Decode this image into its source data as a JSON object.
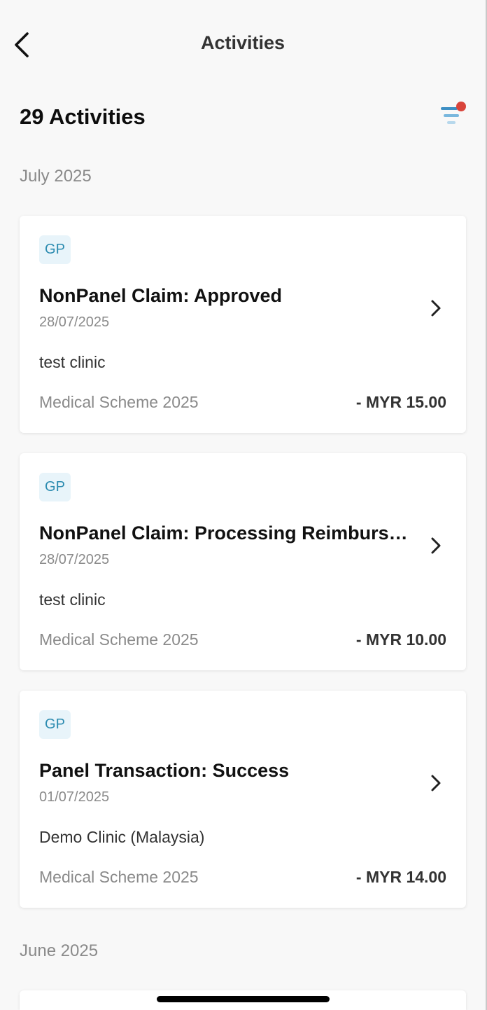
{
  "header": {
    "title": "Activities",
    "back_icon": "chevron-left-icon"
  },
  "summary": {
    "count_label": "29 Activities",
    "filter_icon": "filter-icon",
    "filter_active_dot_color": "#d9443b",
    "filter_icon_colors": [
      "#3d8fc4",
      "#79b7dd",
      "#b7d8ec"
    ]
  },
  "colors": {
    "badge_bg": "#e8f4fa",
    "badge_text": "#2b8bb0",
    "page_bg": "#f8f8f8"
  },
  "groups": [
    {
      "month": "July 2025",
      "activities": [
        {
          "badge": "GP",
          "title": "NonPanel Claim: Approved",
          "date": "28/07/2025",
          "clinic": "test clinic",
          "scheme": "Medical Scheme 2025",
          "amount": "- MYR 15.00"
        },
        {
          "badge": "GP",
          "title": "NonPanel Claim: Processing Reimbursement",
          "date": "28/07/2025",
          "clinic": "test clinic",
          "scheme": "Medical Scheme 2025",
          "amount": "- MYR 10.00"
        },
        {
          "badge": "GP",
          "title": "Panel Transaction: Success",
          "date": "01/07/2025",
          "clinic": "Demo Clinic (Malaysia)",
          "scheme": "Medical Scheme 2025",
          "amount": "- MYR 14.00"
        }
      ]
    },
    {
      "month": "June 2025",
      "activities": []
    }
  ]
}
